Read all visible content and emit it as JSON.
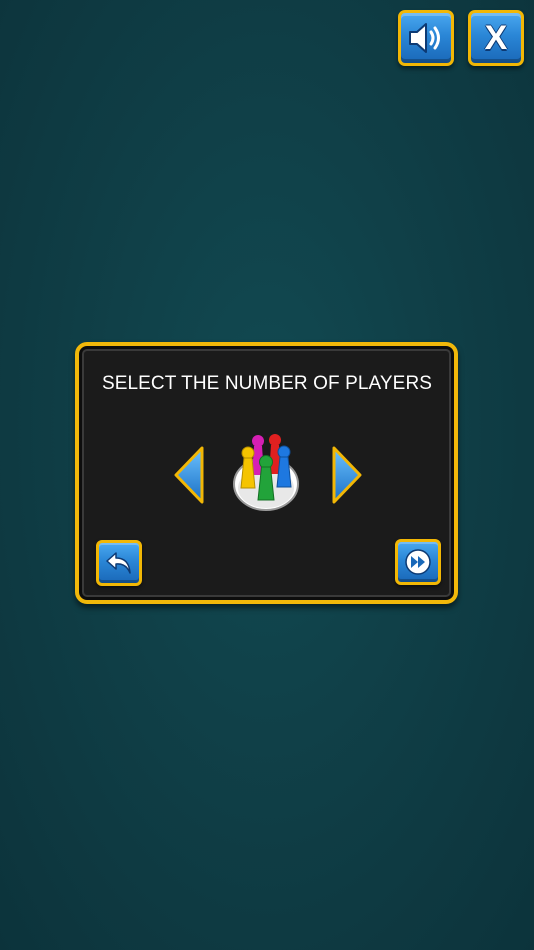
{
  "header": {
    "sound_icon": "speaker-volume-icon",
    "close_label": "X"
  },
  "panel": {
    "title": "SELECT THE NUMBER OF PLAYERS",
    "prev_icon": "chevron-left-icon",
    "next_icon": "chevron-right-icon",
    "players_icon": "player-pawns-icon",
    "back_icon": "undo-arrow-icon",
    "continue_icon": "fast-forward-icon"
  },
  "colors": {
    "background": "#0f3d45",
    "panel_bg": "#1b1b1b",
    "border_gold": "#f1b80a",
    "button_blue": "#2a86d6",
    "pawn_yellow": "#f5c400",
    "pawn_magenta": "#d61fb4",
    "pawn_red": "#e02020",
    "pawn_blue": "#1e78e0",
    "pawn_green": "#22a33a"
  }
}
